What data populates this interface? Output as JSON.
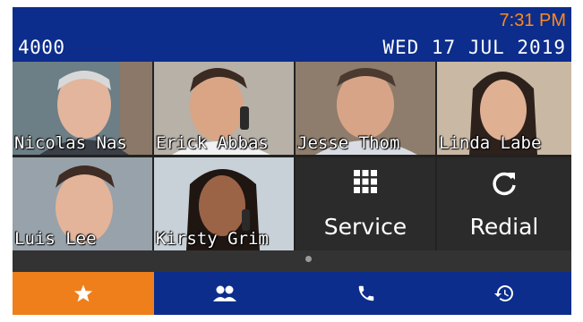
{
  "header": {
    "extension": "4000",
    "time": "7:31 PM",
    "date": "WED 17 JUL 2019"
  },
  "contacts": [
    {
      "name": "Nicolas Nas"
    },
    {
      "name": "Erick Abbas"
    },
    {
      "name": "Jesse Thom"
    },
    {
      "name": "Linda Labe"
    },
    {
      "name": "Luis Lee"
    },
    {
      "name": "Kirsty Grim"
    }
  ],
  "functions": {
    "service_label": "Service",
    "redial_label": "Redial"
  },
  "nav": {
    "tabs": [
      {
        "icon": "star-icon",
        "active": true
      },
      {
        "icon": "contacts-icon",
        "active": false
      },
      {
        "icon": "phone-icon",
        "active": false
      },
      {
        "icon": "history-icon",
        "active": false
      }
    ],
    "colors": {
      "active": "#ef7f1a",
      "bar": "#0c2d8c",
      "time": "#ff8a18"
    }
  }
}
